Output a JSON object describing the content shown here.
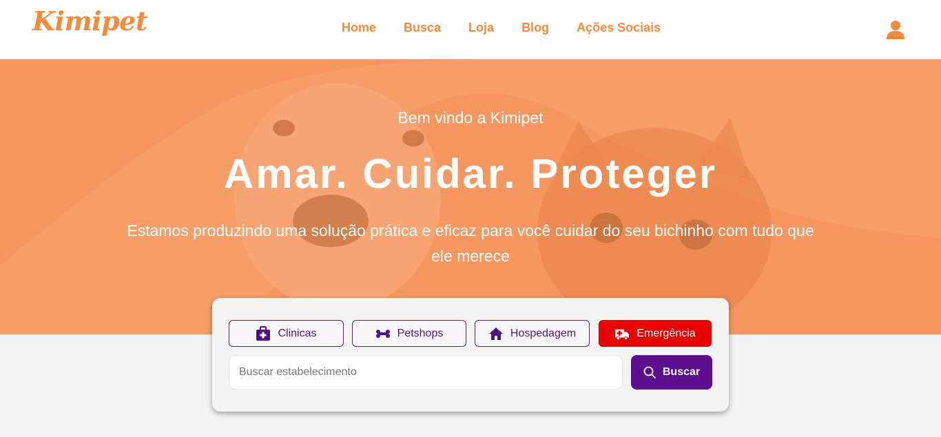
{
  "brand": {
    "logo_text": "Kimipet",
    "accent_color": "#f58a3d"
  },
  "nav": {
    "items": [
      {
        "label": "Home"
      },
      {
        "label": "Busca"
      },
      {
        "label": "Loja"
      },
      {
        "label": "Blog"
      },
      {
        "label": "Ações Sociais"
      }
    ],
    "user_icon": "user-icon"
  },
  "hero": {
    "welcome": "Bem vindo a Kimipet",
    "title": "Amar. Cuidar. Proteger",
    "description": "Estamos produzindo uma solução prática e eficaz para você cuidar do seu bichinho com tudo que ele merece"
  },
  "search": {
    "categories": [
      {
        "label": "Clinicas",
        "icon": "medical-kit-icon"
      },
      {
        "label": "Petshops",
        "icon": "bone-icon"
      },
      {
        "label": "Hospedagem",
        "icon": "house-icon"
      },
      {
        "label": "Emergência",
        "icon": "ambulance-icon"
      }
    ],
    "placeholder": "Buscar estabelecimento",
    "button_label": "Buscar",
    "button_icon": "search-icon",
    "colors": {
      "primary": "#5b0f8f",
      "emergency": "#e60000"
    }
  }
}
